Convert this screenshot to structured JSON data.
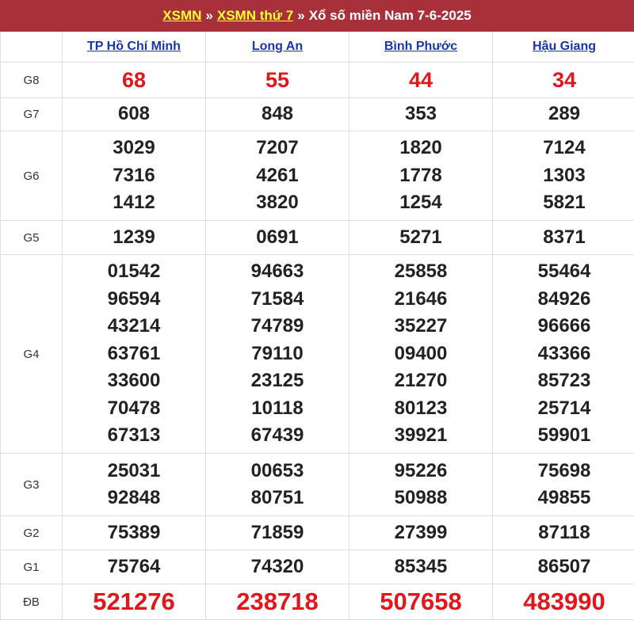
{
  "header": {
    "link1": "XSMN",
    "sep1": "»",
    "link2": "XSMN thứ 7",
    "sep2": "»",
    "title": "Xổ số miền Nam 7-6-2025"
  },
  "provinces": [
    "TP Hồ Chí Minh",
    "Long An",
    "Bình Phước",
    "Hậu Giang"
  ],
  "prizes": [
    {
      "label": "G8",
      "style": "red g8",
      "values": [
        [
          "68"
        ],
        [
          "55"
        ],
        [
          "44"
        ],
        [
          "34"
        ]
      ]
    },
    {
      "label": "G7",
      "style": "",
      "values": [
        [
          "608"
        ],
        [
          "848"
        ],
        [
          "353"
        ],
        [
          "289"
        ]
      ]
    },
    {
      "label": "G6",
      "style": "",
      "values": [
        [
          "3029",
          "7316",
          "1412"
        ],
        [
          "7207",
          "4261",
          "3820"
        ],
        [
          "1820",
          "1778",
          "1254"
        ],
        [
          "7124",
          "1303",
          "5821"
        ]
      ]
    },
    {
      "label": "G5",
      "style": "",
      "values": [
        [
          "1239"
        ],
        [
          "0691"
        ],
        [
          "5271"
        ],
        [
          "8371"
        ]
      ]
    },
    {
      "label": "G4",
      "style": "",
      "values": [
        [
          "01542",
          "96594",
          "43214",
          "63761",
          "33600",
          "70478",
          "67313"
        ],
        [
          "94663",
          "71584",
          "74789",
          "79110",
          "23125",
          "10118",
          "67439"
        ],
        [
          "25858",
          "21646",
          "35227",
          "09400",
          "21270",
          "80123",
          "39921"
        ],
        [
          "55464",
          "84926",
          "96666",
          "43366",
          "85723",
          "25714",
          "59901"
        ]
      ]
    },
    {
      "label": "G3",
      "style": "",
      "values": [
        [
          "25031",
          "92848"
        ],
        [
          "00653",
          "80751"
        ],
        [
          "95226",
          "50988"
        ],
        [
          "75698",
          "49855"
        ]
      ]
    },
    {
      "label": "G2",
      "style": "",
      "values": [
        [
          "75389"
        ],
        [
          "71859"
        ],
        [
          "27399"
        ],
        [
          "87118"
        ]
      ]
    },
    {
      "label": "G1",
      "style": "",
      "values": [
        [
          "75764"
        ],
        [
          "74320"
        ],
        [
          "85345"
        ],
        [
          "86507"
        ]
      ]
    },
    {
      "label": "ĐB",
      "style": "red db",
      "values": [
        [
          "521276"
        ],
        [
          "238718"
        ],
        [
          "507658"
        ],
        [
          "483990"
        ]
      ]
    }
  ]
}
